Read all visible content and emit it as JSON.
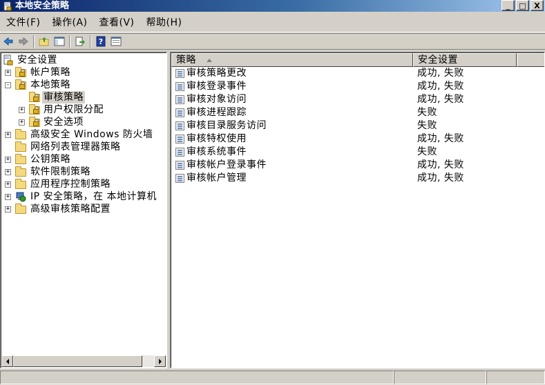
{
  "window": {
    "title": "本地安全策略",
    "icon": "security-policy-icon",
    "controls": {
      "minimize": "_",
      "maximize": "□",
      "close": "X"
    }
  },
  "menu": [
    {
      "label": "文件(F)"
    },
    {
      "label": "操作(A)"
    },
    {
      "label": "查看(V)"
    },
    {
      "label": "帮助(H)"
    }
  ],
  "toolbar": {
    "buttons": [
      "back-icon",
      "forward-icon",
      "up-folder-icon",
      "show-hide-console-tree-icon",
      "export-list-icon",
      "help-icon",
      "properties-icon"
    ]
  },
  "tree": {
    "root": "安全设置",
    "items": [
      {
        "label": "帐户策略",
        "expander": "+"
      },
      {
        "label": "本地策略",
        "expander": "-"
      },
      {
        "label": "审核策略",
        "selected": true
      },
      {
        "label": "用户权限分配",
        "expander": "+"
      },
      {
        "label": "安全选项",
        "expander": "+"
      },
      {
        "label": "高级安全 Windows 防火墙",
        "expander": "+"
      },
      {
        "label": "网络列表管理器策略"
      },
      {
        "label": "公钥策略",
        "expander": "+"
      },
      {
        "label": "软件限制策略",
        "expander": "+"
      },
      {
        "label": "应用程序控制策略",
        "expander": "+"
      },
      {
        "label": "IP 安全策略，在 本地计算机",
        "expander": "+"
      },
      {
        "label": "高级审核策略配置",
        "expander": "+"
      }
    ]
  },
  "list": {
    "columns": [
      "策略",
      "安全设置"
    ],
    "rows": [
      {
        "policy": "审核策略更改",
        "setting": "成功, 失败"
      },
      {
        "policy": "审核登录事件",
        "setting": "成功, 失败"
      },
      {
        "policy": "审核对象访问",
        "setting": "成功, 失败"
      },
      {
        "policy": "审核进程跟踪",
        "setting": "失败"
      },
      {
        "policy": "审核目录服务访问",
        "setting": "失败"
      },
      {
        "policy": "审核特权使用",
        "setting": "成功, 失败"
      },
      {
        "policy": "审核系统事件",
        "setting": "失败"
      },
      {
        "policy": "审核帐户登录事件",
        "setting": "成功, 失败"
      },
      {
        "policy": "审核帐户管理",
        "setting": "成功, 失败"
      }
    ]
  },
  "colors": {
    "titlebar_start": "#0a246a",
    "titlebar_end": "#a6caf0",
    "chrome": "#d4d0c8",
    "selection": "#d4d0c8"
  }
}
